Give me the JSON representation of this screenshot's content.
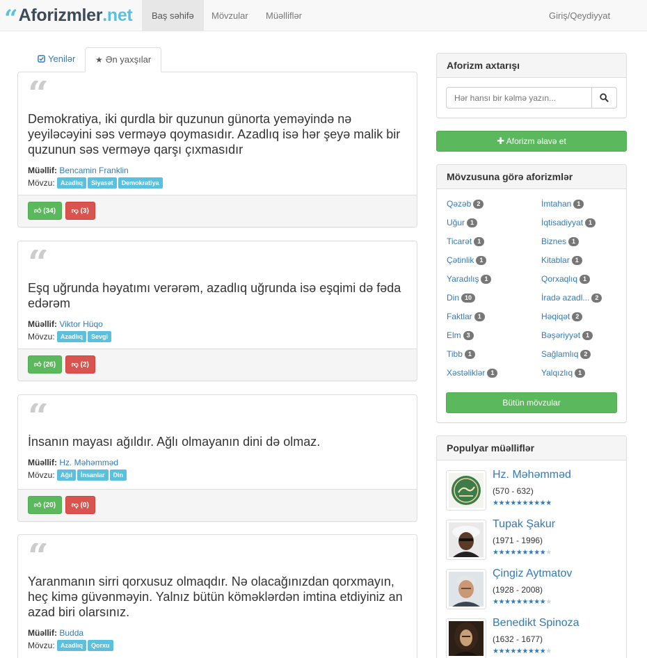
{
  "brand": {
    "quote_glyph": "“",
    "name": "Aforizmler",
    "tld": ".net"
  },
  "nav": {
    "home": "Baş səhifə",
    "topics": "Mövzular",
    "authors": "Müəlliflər",
    "login": "Giriş/Qeydiyyat"
  },
  "tabs": {
    "new": "Yenilər",
    "best": "Ən yaxşılar"
  },
  "quote_glyph": "“",
  "labels": {
    "author": "Müəllif:",
    "topic": "Mövzu:"
  },
  "quotes": [
    {
      "text": "Demokratiya, iki qurdla bir quzunun günorta yeməyində nə yeyiləcəyini səs verməyə qoymasıdır. Azadlıq isə hər şeyə malik bir quzunun səs verməyə qarşı çıxmasıdır",
      "author": "Bencamin Franklin",
      "tags": [
        "Azadlıq",
        "Siyasət",
        "Demokratiya"
      ],
      "up": "(34)",
      "down": "(3)"
    },
    {
      "text": "Eşq uğrunda həyatımı verərəm, azadlıq uğrunda isə eşqimi də fəda edərəm",
      "author": "Viktor Hüqo",
      "tags": [
        "Azadlıq",
        "Sevgi"
      ],
      "up": "(26)",
      "down": "(2)"
    },
    {
      "text": "İnsanın mayası ağıldır. Ağlı olmayanın dini də olmaz.",
      "author": "Hz. Məhəmməd",
      "tags": [
        "Ağıl",
        "İnsanlar",
        "Din"
      ],
      "up": "(20)",
      "down": "(0)"
    },
    {
      "text": "Yaranmanın sirri qorxusuz olmaqdır. Nə olacağınızdan qorxmayın, heç kimə güvənməyin. Yalnız bütün köməklərdən imtina etdiyiniz an azad biri olarsınız.",
      "author": "Budda",
      "tags": [
        "Azadlıq",
        "Qorxu"
      ]
    }
  ],
  "search": {
    "title": "Aforizm axtarışı",
    "placeholder": "Hər hansı bir kəlmə yazın..."
  },
  "add_button": "Aforizm əlavə et",
  "topics_panel": {
    "title": "Mövzusuna görə aforizmlər",
    "left": [
      {
        "name": "Qəzəb",
        "count": "2"
      },
      {
        "name": "Uğur",
        "count": "1"
      },
      {
        "name": "Ticarət",
        "count": "1"
      },
      {
        "name": "Çətinlik",
        "count": "1"
      },
      {
        "name": "Yaradılış",
        "count": "1"
      },
      {
        "name": "Din",
        "count": "10"
      },
      {
        "name": "Faktlar",
        "count": "1"
      },
      {
        "name": "Elm",
        "count": "3"
      },
      {
        "name": "Tibb",
        "count": "1"
      },
      {
        "name": "Xəstəliklər",
        "count": "1"
      }
    ],
    "right": [
      {
        "name": "İmtahan",
        "count": "1"
      },
      {
        "name": "İqtisadiyyat",
        "count": "1"
      },
      {
        "name": "Biznes",
        "count": "1"
      },
      {
        "name": "Kitablar",
        "count": "1"
      },
      {
        "name": "Qorxaqlıq",
        "count": "1"
      },
      {
        "name": "İradə azadl...",
        "count": "2"
      },
      {
        "name": "Həqiqət",
        "count": "2"
      },
      {
        "name": "Bəşəriyyət",
        "count": "1"
      },
      {
        "name": "Sağlamlıq",
        "count": "2"
      },
      {
        "name": "Yalqızlıq",
        "count": "1"
      }
    ],
    "all_button": "Bütün mövzular"
  },
  "authors_panel": {
    "title": "Populyar müəlliflər",
    "star_glyph": "★",
    "authors": [
      {
        "name": "Hz. Məhəmməd",
        "years": "(570 - 632)",
        "rating": 10,
        "max": 10
      },
      {
        "name": "Tupak Şakur",
        "years": "(1971 - 1996)",
        "rating": 9,
        "max": 10
      },
      {
        "name": "Çingiz Aytmatov",
        "years": "(1928 - 2008)",
        "rating": 8.5,
        "max": 10
      },
      {
        "name": "Benedikt Spinoza",
        "years": "(1632 - 1677)",
        "rating": 8.5,
        "max": 10
      }
    ]
  },
  "colors": {
    "accent": "#5bc0de",
    "link": "#337ab7",
    "success": "#5cb85c",
    "danger": "#d9534f",
    "badge": "#777777"
  },
  "icons": {
    "tab_new": "check-square-icon",
    "tab_best": "star-icon",
    "search": "search-icon",
    "add": "plus-icon",
    "up": "thumbs-up-icon",
    "down": "thumbs-down-icon"
  }
}
